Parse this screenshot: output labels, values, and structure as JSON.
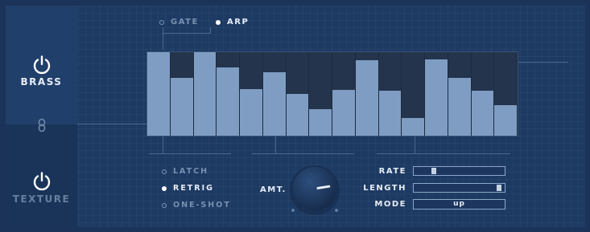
{
  "colors": {
    "active_text": "#e6edf6",
    "inactive_text": "#7890b0",
    "dim_text": "#667f9f",
    "bar_fill": "#7f9dc2",
    "bar_background": "#24344c"
  },
  "sidebar": {
    "top": {
      "label": "BRASS",
      "icon": "power-icon",
      "active": true
    },
    "link_icon": "link-icon",
    "bottom": {
      "label": "TEXTURE",
      "icon": "power-icon",
      "active": false
    }
  },
  "mode_toggle": {
    "options": [
      {
        "label": "GATE",
        "selected": false
      },
      {
        "label": "ARP",
        "selected": true
      }
    ]
  },
  "sequencer": {
    "steps": [
      1.0,
      0.69,
      1.0,
      0.82,
      0.56,
      0.76,
      0.5,
      0.32,
      0.55,
      0.9,
      0.54,
      0.21,
      0.91,
      0.69,
      0.54,
      0.37
    ]
  },
  "trigger_modes": {
    "options": [
      {
        "label": "LATCH",
        "selected": false
      },
      {
        "label": "RETRIG",
        "selected": true
      },
      {
        "label": "ONE-SHOT",
        "selected": false
      }
    ]
  },
  "amount": {
    "label": "AMT.",
    "level": 0.8
  },
  "params": {
    "rate": {
      "label": "RATE",
      "level": 0.2
    },
    "length": {
      "label": "LENGTH",
      "level": 0.97
    },
    "mode": {
      "label": "MODE",
      "value": "up"
    }
  }
}
